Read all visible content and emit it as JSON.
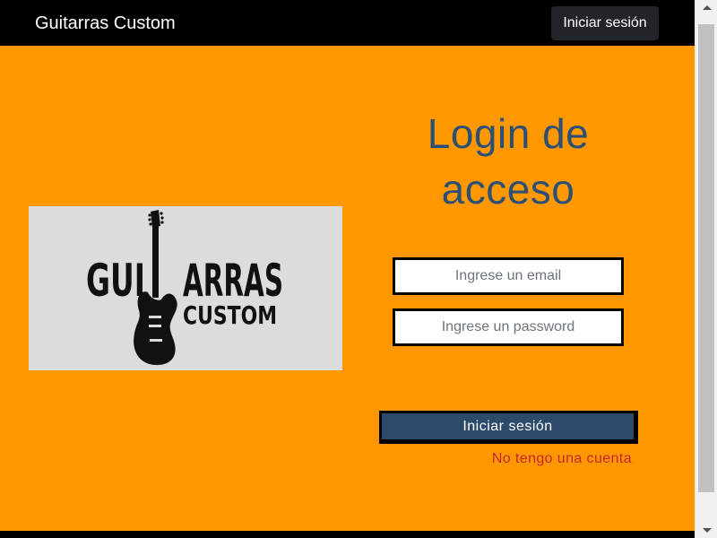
{
  "navbar": {
    "brand": "Guitarras Custom",
    "login_button": "Iniciar sesión"
  },
  "logo": {
    "line1": "GUI",
    "line1b": "ARRAS",
    "line2": "CUSTOM",
    "colors": {
      "background": "#dcdcdc",
      "ink": "#111111"
    }
  },
  "login": {
    "title_line1": "Login de",
    "title_line2": "acceso",
    "email_placeholder": "Ingrese un email",
    "password_placeholder": "Ingrese un password",
    "submit_label": "Iniciar sesión",
    "register_link": "No tengo una cuenta"
  },
  "colors": {
    "page_background": "#ff9800",
    "navbar": "#000000",
    "title": "#2c5073",
    "submit_button": "#2e4a6a",
    "register_link": "#c62828"
  }
}
